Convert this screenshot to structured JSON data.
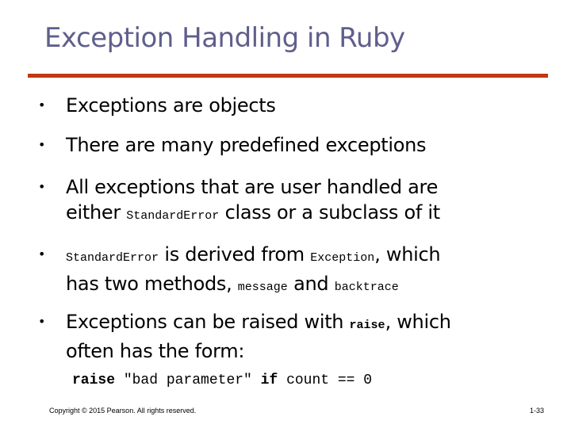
{
  "slide": {
    "title": "Exception Handling in Ruby",
    "bullets": [
      {
        "text": "Exceptions are objects"
      },
      {
        "text": "There are many predefined exceptions"
      },
      {
        "line1": "All exceptions that are user handled are",
        "line2_pre": "either ",
        "code1": "StandardError",
        "line2_post": " class or a subclass of it"
      },
      {
        "code1": "StandardError",
        "mid1": " is derived from ",
        "code2": "Exception",
        "mid2": ", which",
        "line2_pre": "has two methods, ",
        "code3": "message",
        "mid3": " and ",
        "code4": "backtrace"
      },
      {
        "line1_pre": "Exceptions can be raised with ",
        "code1": "raise",
        "line1_post": ", which",
        "line2": "often has the form:"
      }
    ],
    "code_example": {
      "kw1": "raise",
      "str": " \"bad parameter\" ",
      "kw2": "if",
      "rest": " count == 0"
    },
    "bullet_glyph": "•"
  },
  "footer": {
    "copyright": "Copyright © 2015 Pearson. All rights reserved.",
    "page": "1-33"
  }
}
